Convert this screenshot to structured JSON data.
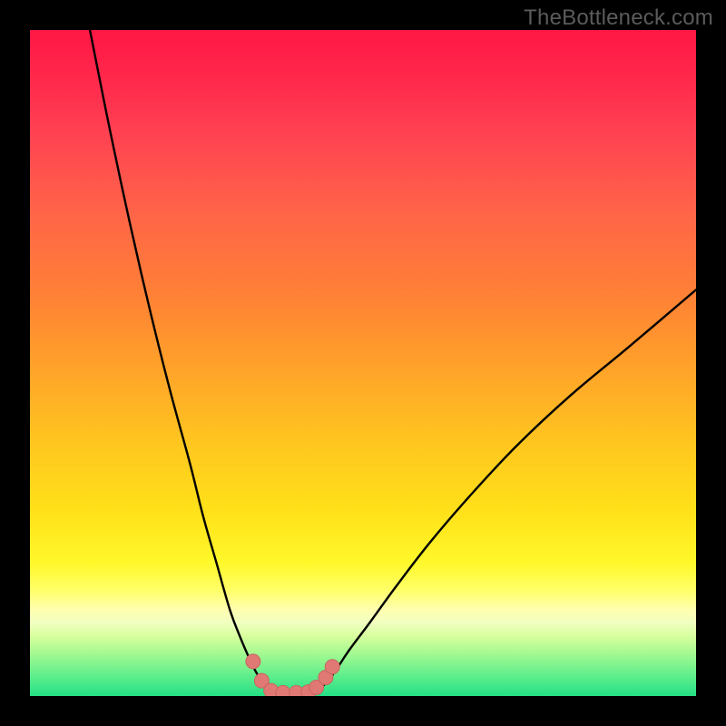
{
  "watermark": "TheBottleneck.com",
  "colors": {
    "background": "#000000",
    "curve": "#000000",
    "marker_fill": "#e07874",
    "marker_stroke": "#c86660"
  },
  "chart_data": {
    "type": "line",
    "title": "",
    "xlabel": "",
    "ylabel": "",
    "xlim": [
      0,
      100
    ],
    "ylim": [
      0,
      100
    ],
    "left_curve": {
      "x": [
        9,
        12,
        15,
        18,
        21,
        24,
        26,
        28,
        30,
        31.5,
        33,
        34,
        35,
        35.8,
        36.5,
        37
      ],
      "y": [
        100,
        85,
        71,
        58,
        46,
        35,
        27,
        20,
        13,
        9,
        5.5,
        3.5,
        2,
        1,
        0.5,
        0.2
      ]
    },
    "right_curve": {
      "x": [
        42,
        43,
        44.5,
        46,
        48,
        51,
        55,
        60,
        66,
        73,
        81,
        90,
        100
      ],
      "y": [
        0.2,
        0.8,
        2,
        4,
        7,
        11,
        16.5,
        23,
        30,
        37.5,
        45,
        52.5,
        61
      ]
    },
    "bottom_segment": {
      "x": [
        37,
        42
      ],
      "y": [
        0.2,
        0.2
      ]
    },
    "markers": [
      {
        "x": 33.5,
        "y": 5.2
      },
      {
        "x": 34.8,
        "y": 2.3
      },
      {
        "x": 36.2,
        "y": 0.8
      },
      {
        "x": 38.0,
        "y": 0.5
      },
      {
        "x": 40.0,
        "y": 0.5
      },
      {
        "x": 41.8,
        "y": 0.6
      },
      {
        "x": 43.0,
        "y": 1.3
      },
      {
        "x": 44.4,
        "y": 2.8
      },
      {
        "x": 45.4,
        "y": 4.4
      }
    ],
    "marker_radius_px": 8
  }
}
